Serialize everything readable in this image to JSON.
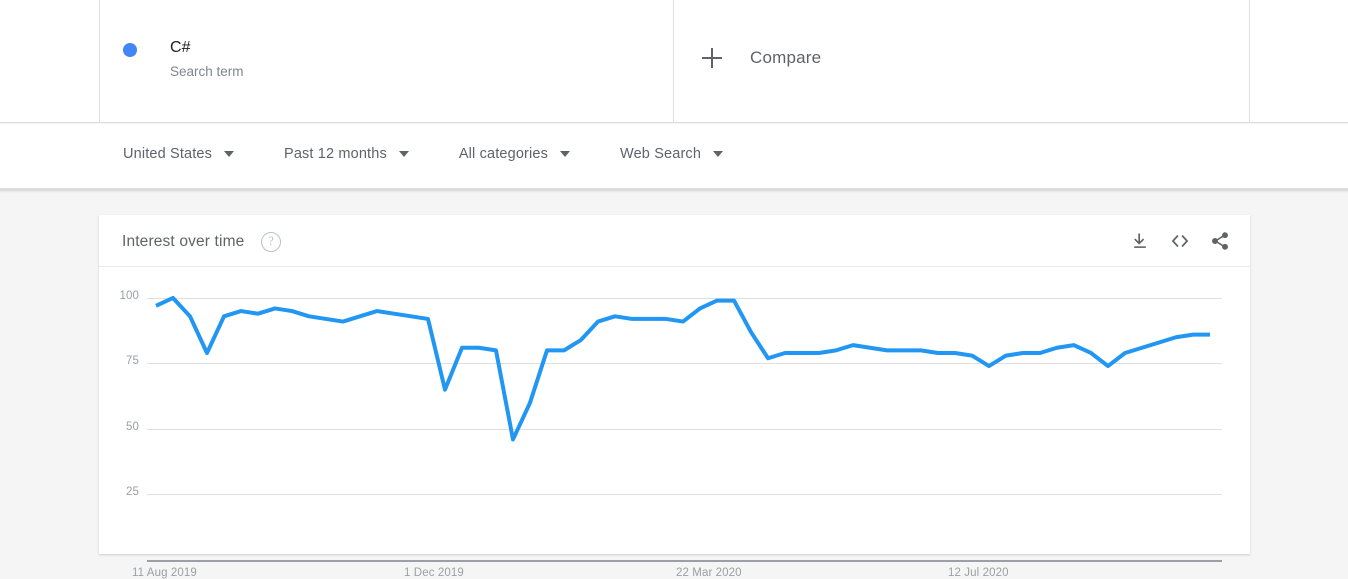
{
  "search_term": {
    "label": "C#",
    "subtitle": "Search term",
    "dot_color": "#4285f4"
  },
  "compare": {
    "label": "Compare",
    "icon": "plus-icon"
  },
  "filters": [
    {
      "label": "United States",
      "icon": "chevron-down-icon"
    },
    {
      "label": "Past 12 months",
      "icon": "chevron-down-icon"
    },
    {
      "label": "All categories",
      "icon": "chevron-down-icon"
    },
    {
      "label": "Web Search",
      "icon": "chevron-down-icon"
    }
  ],
  "card": {
    "title": "Interest over time",
    "help_icon": "help-circle-icon",
    "actions": [
      {
        "name": "download-icon",
        "tooltip": "Download"
      },
      {
        "name": "embed-code-icon",
        "tooltip": "Embed"
      },
      {
        "name": "share-icon",
        "tooltip": "Share"
      }
    ]
  },
  "chart_data": {
    "type": "line",
    "title": "Interest over time",
    "xlabel": "",
    "ylabel": "",
    "ylim": [
      0,
      108
    ],
    "yticks": [
      25,
      50,
      75,
      100
    ],
    "ytick_labels": [
      "25",
      "50",
      "75",
      "100"
    ],
    "grid": true,
    "legend_position": "top",
    "line_color": "#2196f3",
    "line_width": 4,
    "series": [
      {
        "name": "C#",
        "color": "#2196f3",
        "values": [
          97,
          100,
          93,
          79,
          93,
          95,
          94,
          96,
          95,
          93,
          92,
          91,
          93,
          95,
          94,
          93,
          92,
          65,
          81,
          81,
          80,
          46,
          60,
          80,
          80,
          84,
          91,
          93,
          92,
          92,
          92,
          91,
          96,
          99,
          99,
          87,
          77,
          79,
          79,
          79,
          80,
          82,
          81,
          80,
          80,
          80,
          79,
          79,
          78,
          74,
          78,
          79,
          79,
          81,
          82,
          79,
          74,
          79,
          81,
          83,
          85,
          86,
          86
        ]
      }
    ],
    "x_tick_labels": [
      "11 Aug 2019",
      "1 Dec 2019",
      "22 Mar 2020",
      "12 Jul 2020"
    ],
    "x_tick_positions": [
      0,
      16,
      32,
      48
    ],
    "x_start": "11 Aug 2019",
    "x_end": "12 Jul 2020"
  }
}
